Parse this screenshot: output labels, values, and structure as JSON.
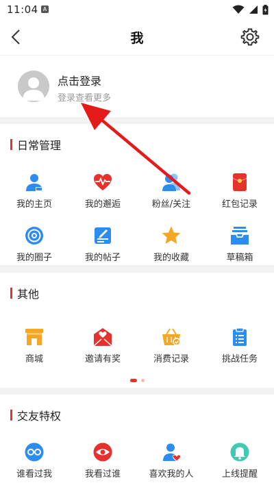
{
  "status": {
    "time": "11:04",
    "notice": "A"
  },
  "header": {
    "title": "我"
  },
  "profile": {
    "login_title": "点击登录",
    "login_subtitle": "登录查看更多"
  },
  "daily": {
    "title": "日常管理",
    "items": [
      {
        "label": "我的主页",
        "icon": "homepage-icon"
      },
      {
        "label": "我的邂逅",
        "icon": "heart-pulse-icon"
      },
      {
        "label": "粉丝/关注",
        "icon": "fans-icon"
      },
      {
        "label": "红包记录",
        "icon": "red-envelope-icon"
      },
      {
        "label": "我的圈子",
        "icon": "circle-target-icon"
      },
      {
        "label": "我的帖子",
        "icon": "post-edit-icon"
      },
      {
        "label": "我的收藏",
        "icon": "star-icon"
      },
      {
        "label": "草稿箱",
        "icon": "inbox-tray-icon"
      }
    ]
  },
  "other": {
    "title": "其他",
    "items": [
      {
        "label": "商城",
        "icon": "shop-icon"
      },
      {
        "label": "邀请有奖",
        "icon": "invite-envelope-icon"
      },
      {
        "label": "消费记录",
        "icon": "basket-icon"
      },
      {
        "label": "挑战任务",
        "icon": "clipboard-icon"
      }
    ]
  },
  "friends": {
    "title": "交友特权",
    "items": [
      {
        "label": "谁看过我",
        "icon": "glasses-icon"
      },
      {
        "label": "我看过谁",
        "icon": "eye-icon"
      },
      {
        "label": "喜欢我的人",
        "icon": "user-heart-icon"
      },
      {
        "label": "上线提醒",
        "icon": "bell-icon"
      }
    ]
  },
  "colors": {
    "accent": "#e5322d",
    "blue": "#2d8cf0",
    "orange": "#f5a623",
    "teal": "#41c9b4"
  }
}
